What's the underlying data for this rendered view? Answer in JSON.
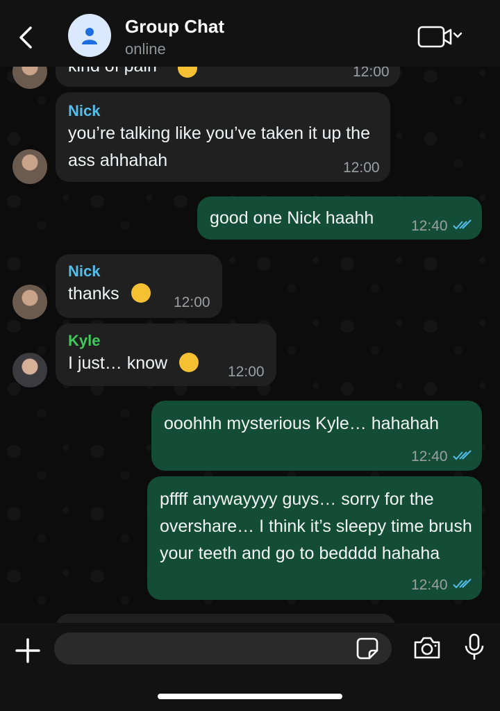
{
  "header": {
    "title": "Group Chat",
    "status": "online"
  },
  "messages": [
    {
      "direction": "in",
      "text": "kind of pain",
      "emoji": "wink",
      "time": "12:00"
    },
    {
      "direction": "in",
      "sender": "Nick",
      "text": "you’re talking like you’ve taken it up the ass ahhahah",
      "time": "12:00"
    },
    {
      "direction": "out",
      "text": "good one Nick haahh",
      "time": "12:40",
      "status": "read"
    },
    {
      "direction": "in",
      "sender": "Nick",
      "text": "thanks",
      "emoji": "laughing-tears",
      "time": "12:00"
    },
    {
      "direction": "in",
      "sender": "Kyle",
      "text": "I just… know",
      "emoji": "wink",
      "time": "12:00"
    },
    {
      "direction": "out",
      "text": "ooohhh mysterious Kyle… hahahah",
      "time": "12:40",
      "status": "read"
    },
    {
      "direction": "out",
      "text": "pffff anywayyyy guys… sorry for the overshare… I think it’s sleepy time brush your teeth and go to bedddd hahaha",
      "time": "12:40",
      "status": "read"
    }
  ],
  "composer": {
    "value": "",
    "placeholder": ""
  },
  "colors": {
    "incoming_bubble": "#202020",
    "outgoing_bubble": "#134d37",
    "nick_name": "#53bdeb",
    "kyle_name": "#3fca5a",
    "read_ticks": "#53bdeb"
  },
  "icons": {
    "back": "chevron-left-icon",
    "video": "video-camera-icon",
    "plus": "plus-icon",
    "sticker": "sticker-icon",
    "camera": "camera-icon",
    "mic": "microphone-icon"
  }
}
